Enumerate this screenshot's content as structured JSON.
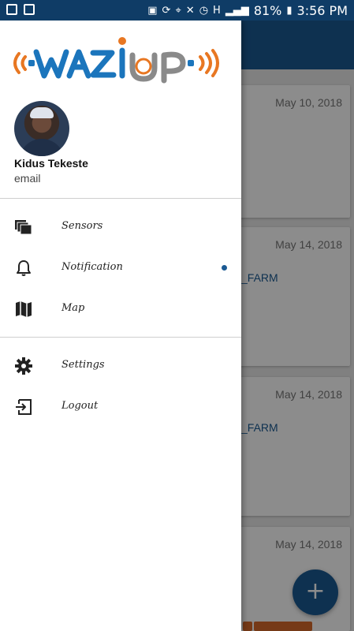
{
  "status_bar": {
    "battery": "81%",
    "time": "3:56 PM",
    "icons": [
      "image-icon",
      "download-icon",
      "nfc-icon",
      "sync-icon",
      "location-icon",
      "mute-icon",
      "alarm-icon",
      "h-signal-icon",
      "signal-bars-icon",
      "battery-icon"
    ]
  },
  "background": {
    "cards": [
      {
        "date": "May 10, 2018",
        "title": ""
      },
      {
        "date": "May 14, 2018",
        "title": "_FARM"
      },
      {
        "date": "May 14, 2018",
        "title": "_FARM"
      },
      {
        "date": "May 14, 2018",
        "title": ""
      }
    ],
    "fab_label": "+"
  },
  "drawer": {
    "logo_text": "WAZIUP",
    "user": {
      "name": "Kidus Tekeste",
      "email": "email"
    },
    "items": [
      {
        "label": "Sensors",
        "icon": "sensors-icon"
      },
      {
        "label": "Notification",
        "icon": "bell-icon"
      },
      {
        "label": "Map",
        "icon": "map-icon"
      },
      {
        "label": "Settings",
        "icon": "gear-icon"
      },
      {
        "label": "Logout",
        "icon": "logout-icon"
      }
    ]
  },
  "colors": {
    "primary": "#1b5a93",
    "status_bar": "#0f3c66",
    "logo_orange": "#e87722",
    "logo_blue": "#1b75bc",
    "logo_grey": "#8a8a8a"
  }
}
